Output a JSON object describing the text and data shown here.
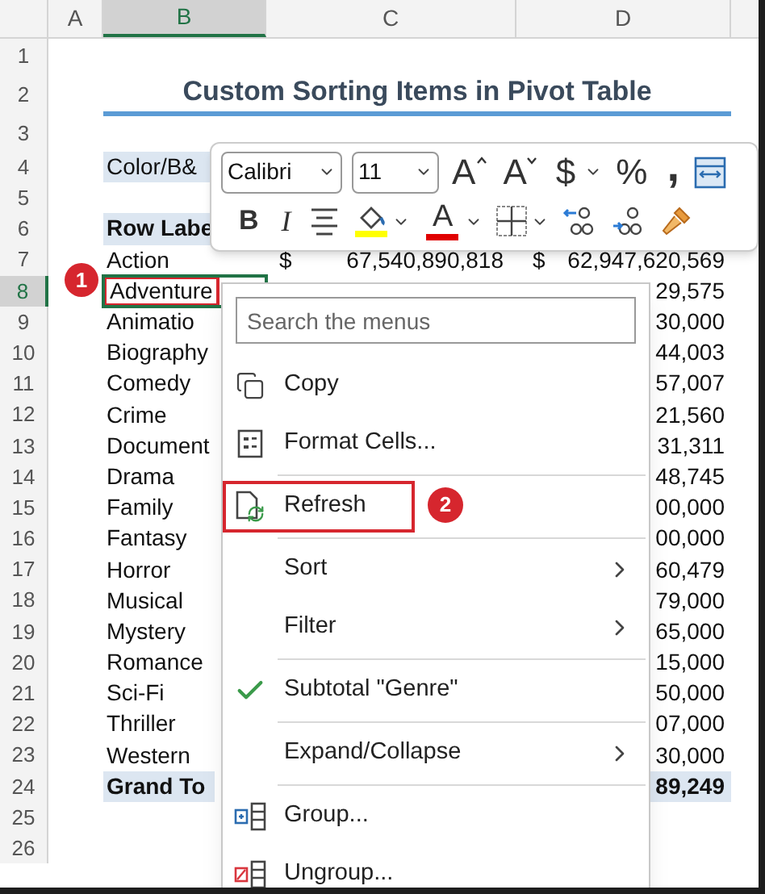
{
  "sheet": {
    "columns": [
      {
        "label": "A",
        "selected": false
      },
      {
        "label": "B",
        "selected": true
      },
      {
        "label": "C",
        "selected": false
      },
      {
        "label": "D",
        "selected": false
      }
    ],
    "rows": [
      {
        "number": "1",
        "selected": false,
        "kind": "empty"
      },
      {
        "number": "2",
        "selected": false,
        "kind": "title",
        "label": "Custom Sorting Items in Pivot Table"
      },
      {
        "number": "3",
        "selected": false,
        "kind": "empty"
      },
      {
        "number": "4",
        "selected": false,
        "kind": "filter",
        "label": "Color/B&"
      },
      {
        "number": "5",
        "selected": false,
        "kind": "empty"
      },
      {
        "number": "6",
        "selected": false,
        "kind": "header",
        "label": "Row Labe"
      },
      {
        "number": "7",
        "selected": false,
        "kind": "data",
        "label": "Action",
        "c_symbol": "$",
        "c_value": "67,540,890,818",
        "d_symbol": "$",
        "d_value": "62,947,620,569"
      },
      {
        "number": "8",
        "selected": true,
        "kind": "data",
        "label": "Adventure",
        "d_value": "29,575"
      },
      {
        "number": "9",
        "selected": false,
        "kind": "data",
        "label": "Animatio",
        "d_value": "30,000"
      },
      {
        "number": "10",
        "selected": false,
        "kind": "data",
        "label": "Biography",
        "d_value": "44,003"
      },
      {
        "number": "11",
        "selected": false,
        "kind": "data",
        "label": "Comedy",
        "d_value": "57,007"
      },
      {
        "number": "12",
        "selected": false,
        "kind": "data",
        "label": "Crime",
        "d_value": "21,560"
      },
      {
        "number": "13",
        "selected": false,
        "kind": "data",
        "label": "Document",
        "d_value": "31,311"
      },
      {
        "number": "14",
        "selected": false,
        "kind": "data",
        "label": "Drama",
        "d_value": "48,745"
      },
      {
        "number": "15",
        "selected": false,
        "kind": "data",
        "label": "Family",
        "d_value": "00,000"
      },
      {
        "number": "16",
        "selected": false,
        "kind": "data",
        "label": "Fantasy",
        "d_value": "00,000"
      },
      {
        "number": "17",
        "selected": false,
        "kind": "data",
        "label": "Horror",
        "d_value": "60,479"
      },
      {
        "number": "18",
        "selected": false,
        "kind": "data",
        "label": "Musical",
        "d_value": "79,000"
      },
      {
        "number": "19",
        "selected": false,
        "kind": "data",
        "label": "Mystery",
        "d_value": "65,000"
      },
      {
        "number": "20",
        "selected": false,
        "kind": "data",
        "label": "Romance",
        "d_value": "15,000"
      },
      {
        "number": "21",
        "selected": false,
        "kind": "data",
        "label": "Sci-Fi",
        "d_value": "50,000"
      },
      {
        "number": "22",
        "selected": false,
        "kind": "data",
        "label": "Thriller",
        "d_value": "07,000"
      },
      {
        "number": "23",
        "selected": false,
        "kind": "data",
        "label": "Western",
        "d_value": "30,000"
      },
      {
        "number": "24",
        "selected": false,
        "kind": "total",
        "label": "Grand To",
        "d_value": "89,249"
      },
      {
        "number": "25",
        "selected": false,
        "kind": "empty"
      },
      {
        "number": "26",
        "selected": false,
        "kind": "empty"
      }
    ]
  },
  "mini_toolbar": {
    "font": "Calibri",
    "size": "11",
    "row1": [
      {
        "kind": "grow",
        "label": "A",
        "menu": false
      },
      {
        "kind": "shrink",
        "label": "A",
        "menu": false
      },
      {
        "kind": "text",
        "label": "$",
        "menu": true
      },
      {
        "kind": "text",
        "label": "%",
        "menu": false
      },
      {
        "kind": "comma",
        "label": ",",
        "menu": false
      },
      {
        "kind": "wrap",
        "menu": false
      }
    ],
    "row2": [
      {
        "kind": "bold",
        "label": "B",
        "menu": false
      },
      {
        "kind": "italic",
        "label": "I",
        "menu": false
      },
      {
        "kind": "align",
        "menu": false
      },
      {
        "kind": "fill",
        "menu": true
      },
      {
        "kind": "font_color",
        "label": "A",
        "menu": true
      },
      {
        "kind": "borders",
        "menu": true
      },
      {
        "kind": "inc_decimal",
        "menu": false
      },
      {
        "kind": "dec_decimal",
        "menu": false
      },
      {
        "kind": "painter",
        "menu": false
      }
    ]
  },
  "context_menu": {
    "search": {
      "placeholder": "Search the menus"
    },
    "items": [
      {
        "kind": "copy",
        "label": "Copy",
        "submenu": false,
        "checked": false,
        "annotated": false
      },
      {
        "kind": "format",
        "label": "Format Cells...",
        "submenu": false,
        "checked": false,
        "annotated": false
      },
      {
        "kind": "separator"
      },
      {
        "kind": "refresh",
        "label": "Refresh",
        "submenu": false,
        "checked": false,
        "annotated": true
      },
      {
        "kind": "separator"
      },
      {
        "kind": "plain",
        "label": "Sort",
        "submenu": true,
        "checked": false,
        "annotated": false
      },
      {
        "kind": "plain",
        "label": "Filter",
        "submenu": true,
        "checked": false,
        "annotated": false
      },
      {
        "kind": "separator"
      },
      {
        "kind": "plain",
        "label": "Subtotal \"Genre\"",
        "submenu": false,
        "checked": true,
        "annotated": false
      },
      {
        "kind": "separator"
      },
      {
        "kind": "plain",
        "label": "Expand/Collapse",
        "submenu": true,
        "checked": false,
        "annotated": false
      },
      {
        "kind": "separator"
      },
      {
        "kind": "group",
        "label": "Group...",
        "submenu": false,
        "checked": false,
        "annotated": false
      },
      {
        "kind": "ungroup",
        "label": "Ungroup...",
        "submenu": false,
        "checked": false,
        "annotated": false
      }
    ]
  },
  "callouts": [
    {
      "label": "1"
    },
    {
      "label": "2"
    }
  ]
}
